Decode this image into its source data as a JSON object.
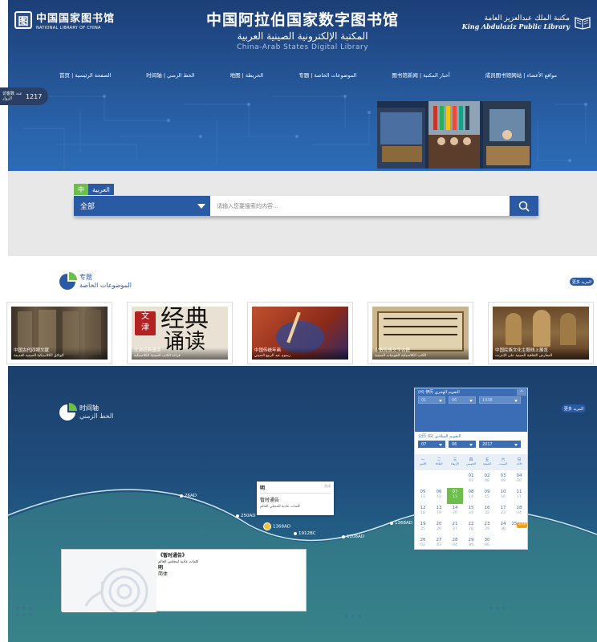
{
  "header": {
    "logo_left_cn": "中国国家图书馆",
    "logo_left_en": "NATIONAL LIBRARY OF CHINA",
    "title_cn": "中国阿拉伯国家数字图书馆",
    "title_ar": "المكتبة الإلكترونية الصينية العربية",
    "title_en": "China-Arab States Digital Library",
    "logo_right_ar": "مكتبة الملك عبدالعزيز العامة",
    "logo_right_en": "King Abdulaziz Public Library"
  },
  "nav": [
    "首页 | الصفحة الرئيسية",
    "时间轴 | الخط الزمني",
    "地图 | الخريطة",
    "专题 | الموضوعات الخاصة",
    "图书馆新闻 | أخبار المكتبة",
    "成员图书馆网站 | مواقع الأعضاء"
  ],
  "visitor": {
    "label": "访客数 عدد الزوار",
    "count": "1217"
  },
  "search": {
    "lang_zh": "中",
    "lang_ar": "العربية",
    "scope": "全部",
    "placeholder": "请输入您要搜索的内容..."
  },
  "topics": {
    "title_cn": "专题",
    "title_ar": "الموضوعات الخاصة",
    "more": "更多 المزيد",
    "cards": [
      {
        "cn": "中国古代四眼文献",
        "ar": "الوثائق الكلاسيكية الصينية القديمة"
      },
      {
        "cn": "文津经典诵读",
        "ar": "قراءة الكتب الصينية الكلاسيكية"
      },
      {
        "cn": "中国传统年画",
        "ar": "رسوم عيد الربيع الصيني"
      },
      {
        "cn": "少数民族文字古籍",
        "ar": "الكتب الكلاسيكية للقوميات الصينية"
      },
      {
        "cn": "中国民族文化主题线上展览",
        "ar": "المعارض الثقافية الصينية على الإنترنت"
      }
    ]
  },
  "timeline": {
    "title_cn": "时间轴",
    "title_ar": "الخط الزمني",
    "more": "更多 المزيد",
    "points": [
      "26AD",
      "250AD",
      "1368AD",
      "1912BC",
      "1206AD",
      "1368AD"
    ],
    "popup": {
      "title": "明",
      "close": "关闭",
      "text": "暂时通告",
      "ar": "كلمات عادية للمجلي العالم"
    },
    "detail": {
      "title": "《暂时通告》",
      "ar": "كلمات عادية لمجلس العالم",
      "dynasty": "明",
      "note": "简体"
    }
  },
  "calendar": {
    "hijri_label": "(H) 伊历 التقويم الهجري",
    "hijri_day": "01",
    "hijri_month": "06",
    "hijri_year": "1438",
    "greg_label": "公历 (G) التقويم الميلادي",
    "greg_day": "07",
    "greg_month": "06",
    "greg_year": "2017",
    "weekdays": [
      {
        "cn": "一",
        "ar": "الاثنين"
      },
      {
        "cn": "二",
        "ar": "الثلاثاء"
      },
      {
        "cn": "三",
        "ar": "الأربعاء"
      },
      {
        "cn": "四",
        "ar": "الخميس"
      },
      {
        "cn": "五",
        "ar": "الجمعة"
      },
      {
        "cn": "六",
        "ar": "السبت"
      },
      {
        "cn": "日",
        "ar": "الأحد"
      }
    ],
    "cells": [
      {
        "d": "",
        "h": ""
      },
      {
        "d": "",
        "h": ""
      },
      {
        "d": "",
        "h": ""
      },
      {
        "d": "01",
        "h": "07"
      },
      {
        "d": "02",
        "h": "08"
      },
      {
        "d": "03",
        "h": "09"
      },
      {
        "d": "04",
        "h": "10"
      },
      {
        "d": "05",
        "h": "11"
      },
      {
        "d": "06",
        "h": "12"
      },
      {
        "d": "07",
        "h": "13",
        "today": true
      },
      {
        "d": "08",
        "h": "14"
      },
      {
        "d": "09",
        "h": "15"
      },
      {
        "d": "10",
        "h": "16"
      },
      {
        "d": "11",
        "h": "17"
      },
      {
        "d": "12",
        "h": "18"
      },
      {
        "d": "13",
        "h": "19"
      },
      {
        "d": "14",
        "h": "20"
      },
      {
        "d": "15",
        "h": "21"
      },
      {
        "d": "16",
        "h": "22"
      },
      {
        "d": "17",
        "h": "23"
      },
      {
        "d": "18",
        "h": "24"
      },
      {
        "d": "19",
        "h": "25"
      },
      {
        "d": "20",
        "h": "26"
      },
      {
        "d": "21",
        "h": "27"
      },
      {
        "d": "22",
        "h": "28"
      },
      {
        "d": "23",
        "h": "29"
      },
      {
        "d": "24",
        "h": "30"
      },
      {
        "d": "25",
        "h": "1/10",
        "hl": true
      },
      {
        "d": "26",
        "h": "02"
      },
      {
        "d": "27",
        "h": "03"
      },
      {
        "d": "28",
        "h": "04"
      },
      {
        "d": "29",
        "h": "05"
      },
      {
        "d": "30",
        "h": "06"
      },
      {
        "d": "",
        "h": ""
      },
      {
        "d": "",
        "h": ""
      }
    ]
  }
}
